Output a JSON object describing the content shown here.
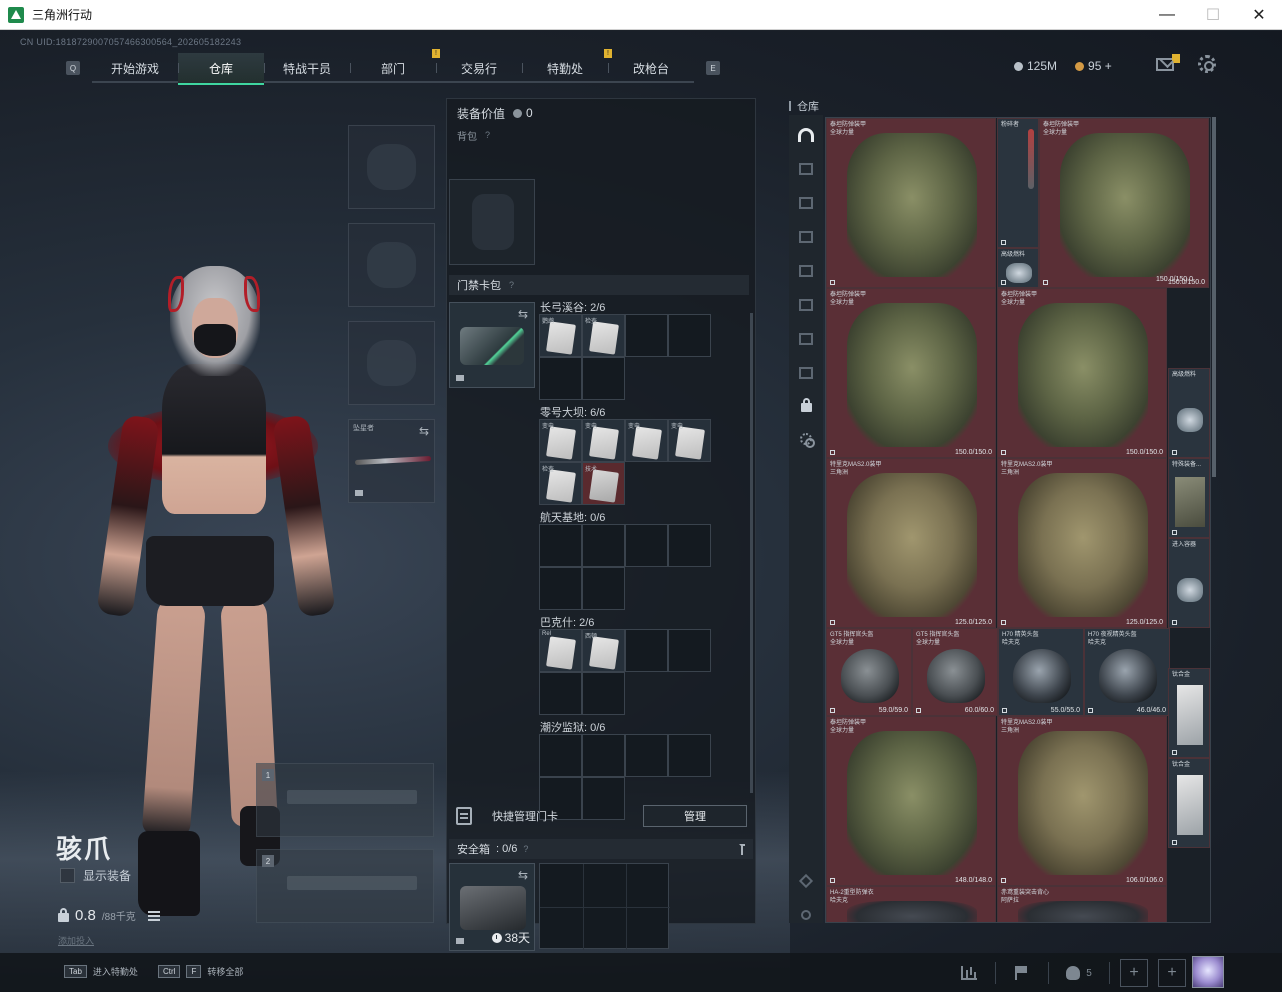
{
  "window": {
    "title": "三角洲行动",
    "controls": {
      "minimize": "—",
      "maximize": "☐",
      "close": "✕"
    }
  },
  "uid_text": "CN UID:1818729007057466300564_202605182243",
  "nav": {
    "left_key": "Q",
    "right_key": "E",
    "tabs": [
      {
        "label": "开始游戏",
        "active": false,
        "badge": false
      },
      {
        "label": "仓库",
        "active": true,
        "badge": false
      },
      {
        "label": "特战干员",
        "active": false,
        "badge": false
      },
      {
        "label": "部门",
        "active": false,
        "badge": true
      },
      {
        "label": "交易行",
        "active": false,
        "badge": false
      },
      {
        "label": "特勤处",
        "active": false,
        "badge": true
      },
      {
        "label": "改枪台",
        "active": false,
        "badge": false
      }
    ],
    "badge_text": "!"
  },
  "currency": {
    "silver": "125M",
    "gold": "95",
    "gold_plus": "+"
  },
  "character": {
    "name": "骇爪",
    "show_equipment_label": "显示装备",
    "weight_value": "0.8",
    "weight_capacity": "/88千克",
    "tiny_link": "添加投入"
  },
  "equipment": {
    "melee_label": "坠星者",
    "weapon_slot_1": "1",
    "weapon_slot_2": "2",
    "swap_glyph": "⇆"
  },
  "middle": {
    "equip_value_label": "装备价值",
    "equip_value": "0",
    "backpack_label": "背包",
    "keycard_pack_label": "门禁卡包",
    "help_glyph": "?",
    "maps": [
      {
        "name": "长弓溪谷: 2/6",
        "cards": [
          {
            "text": "鹦鹉",
            "red": false
          },
          {
            "text": "检查",
            "red": false
          }
        ]
      },
      {
        "name": "零号大坝: 6/6",
        "cards": [
          {
            "text": "变电",
            "red": false
          },
          {
            "text": "变电",
            "red": false
          },
          {
            "text": "变电",
            "red": false
          },
          {
            "text": "变电",
            "red": false
          },
          {
            "text": "检查",
            "red": false
          },
          {
            "text": "技术",
            "red": true
          }
        ]
      },
      {
        "name": "航天基地: 0/6",
        "cards": []
      },
      {
        "name": "巴克什: 2/6",
        "cards": [
          {
            "text": "Rel",
            "red": false
          },
          {
            "text": "西顿",
            "red": false
          }
        ]
      },
      {
        "name": "潮汐监狱: 0/6",
        "cards": []
      }
    ],
    "quick_manage_label": "快捷管理门卡",
    "manage_button": "管理",
    "safe_box_label": "安全箱",
    "safe_box_count": ": 0/6",
    "safe_box_timer": "38天"
  },
  "warehouse": {
    "title": "仓库",
    "items": [
      {
        "name": "泰坦防弹装甲\n全球力量",
        "durability": "",
        "kind": "vest-green",
        "red": true
      },
      {
        "name": "粉碎者",
        "durability": "",
        "kind": "thin",
        "red": false
      },
      {
        "name": "泰坦防弹装甲\n全球力量",
        "durability": "150.0/150.0",
        "kind": "vest-green",
        "red": true
      },
      {
        "name": "高级燃料",
        "durability": "",
        "kind": "can",
        "red": false
      },
      {
        "name": "",
        "durability": "150.0/150.0",
        "kind": "label-only",
        "red": true
      },
      {
        "name": "泰坦防弹装甲\n全球力量",
        "durability": "150.0/150.0",
        "kind": "vest-green",
        "red": true
      },
      {
        "name": "泰坦防弹装甲\n全球力量",
        "durability": "150.0/150.0",
        "kind": "vest-green",
        "red": true
      },
      {
        "name": "高级燃料",
        "durability": "",
        "kind": "can",
        "red": false
      },
      {
        "name": "特里克MAS2.0装甲\n三角洲",
        "durability": "125.0/125.0",
        "kind": "vest-camo",
        "red": true
      },
      {
        "name": "特里克MAS2.0装甲\n三角洲",
        "durability": "125.0/125.0",
        "kind": "vest-camo",
        "red": true
      },
      {
        "name": "特殊装备...",
        "durability": "",
        "kind": "plate-dark",
        "red": false
      },
      {
        "name": "进入容器",
        "durability": "",
        "kind": "can",
        "red": false
      },
      {
        "name": "GT5 指挥官头盔\n全球力量",
        "durability": "59.0/59.0",
        "kind": "helmet",
        "red": true
      },
      {
        "name": "GT5 指挥官头盔\n全球力量",
        "durability": "60.0/60.0",
        "kind": "helmet",
        "red": true
      },
      {
        "name": "H70 精英头盔\n哈夫克",
        "durability": "55.0/55.0",
        "kind": "helmet-dark",
        "red": false
      },
      {
        "name": "H70 夜视精英头盔\n哈夫克",
        "durability": "46.0/46.0",
        "kind": "helmet-dark",
        "red": false
      },
      {
        "name": "钛合金",
        "durability": "",
        "kind": "plate",
        "red": false
      },
      {
        "name": "泰坦防弹装甲\n全球力量",
        "durability": "148.0/148.0",
        "kind": "vest-green",
        "red": true
      },
      {
        "name": "特里克MAS2.0装甲\n三角洲",
        "durability": "106.0/106.0",
        "kind": "vest-camo",
        "red": true
      },
      {
        "name": "钛合金",
        "durability": "",
        "kind": "plate",
        "red": false
      },
      {
        "name": "HA-2重型防弹衣\n哈夫克",
        "durability": "",
        "kind": "vest-dark",
        "red": true
      },
      {
        "name": "赤鸢重装突击背心\n阿萨拉",
        "durability": "",
        "kind": "vest-dark",
        "red": true
      }
    ]
  },
  "bottom": {
    "hint1_key": "Tab",
    "hint1_text": "进入特勤处",
    "hint2_key1": "Ctrl",
    "hint2_key2": "F",
    "hint2_text": "转移全部",
    "friends_count": "5",
    "plus": "+"
  }
}
